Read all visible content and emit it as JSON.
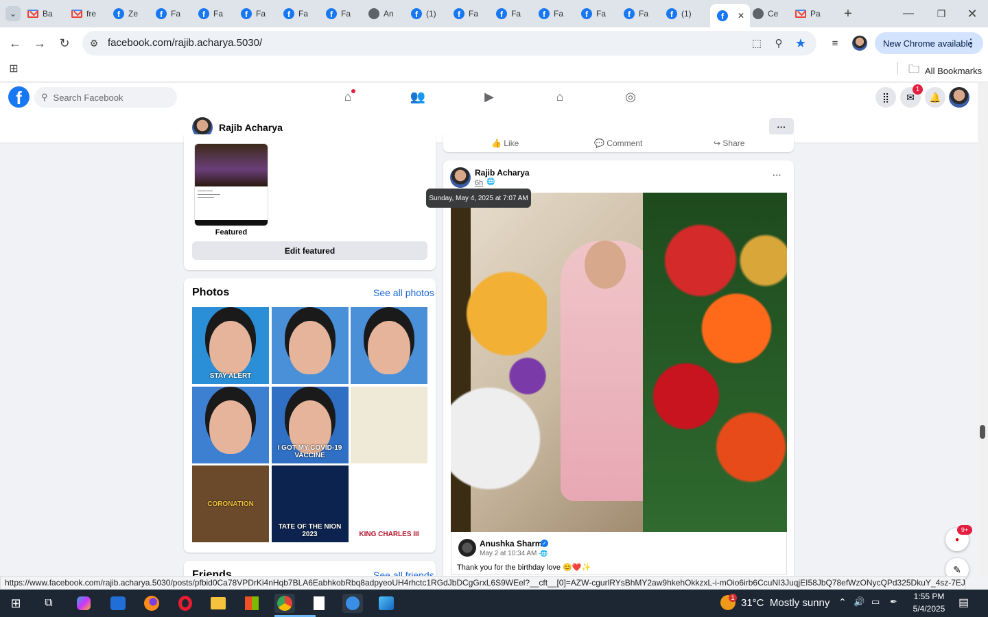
{
  "browser": {
    "tabs": [
      {
        "icon": "gmail-icon",
        "label": "Ba"
      },
      {
        "icon": "gmail-icon",
        "label": "fre"
      },
      {
        "icon": "facebook-icon",
        "label": "Ze"
      },
      {
        "icon": "facebook-icon",
        "label": "Fa"
      },
      {
        "icon": "facebook-icon",
        "label": "Fa"
      },
      {
        "icon": "facebook-icon",
        "label": "Fa"
      },
      {
        "icon": "facebook-icon",
        "label": "Fa"
      },
      {
        "icon": "facebook-icon",
        "label": "Fa"
      },
      {
        "icon": "globe-icon",
        "label": "An"
      },
      {
        "icon": "facebook-icon",
        "label": "(1)"
      },
      {
        "icon": "facebook-icon",
        "label": "Fa"
      },
      {
        "icon": "facebook-icon",
        "label": "Fa"
      },
      {
        "icon": "facebook-icon",
        "label": "Fa"
      },
      {
        "icon": "facebook-icon",
        "label": "Fa"
      },
      {
        "icon": "facebook-icon",
        "label": "Fa"
      },
      {
        "icon": "facebook-icon",
        "label": "(1)"
      },
      {
        "icon": "facebook-icon",
        "label": "",
        "active": true
      },
      {
        "icon": "globe-icon",
        "label": "Ce"
      },
      {
        "icon": "gmail-icon",
        "label": "Pa"
      }
    ],
    "url": "facebook.com/rajib.acharya.5030/",
    "new_chrome": "New Chrome available",
    "all_bookmarks": "All Bookmarks",
    "status_url": "https://www.facebook.com/rajib.acharya.5030/posts/pfbid0Ca78VPDrKi4nHqb7BLA6EabhkobRbq8adpyeoUH4rhctc1RGdJbDCgGrxL6S9WEel?__cft__[0]=AZW-cgurlRYsBhMY2aw9hkehOkkzxL-i-mOio6irb6CcuNI3JuqjEI58JbQ78efWzONycQPd325DkuY_4sz-7EJsisGU..."
  },
  "facebook": {
    "search_placeholder": "Search Facebook",
    "messenger_badge": "1",
    "profile_name": "Rajib Acharya",
    "featured_label": "Featured",
    "edit_featured": "Edit featured",
    "photos_title": "Photos",
    "see_all_photos": "See all photos",
    "friends_title": "Friends",
    "see_all_friends": "See all friends",
    "prev_post_actions": [
      "Like",
      "Comment",
      "Share"
    ],
    "post": {
      "author": "Rajib Acharya",
      "time": "6h",
      "tooltip": "Sunday, May 4, 2025 at 7:07 AM",
      "shared_author": "Anushka Sharma",
      "shared_time": "May 2 at 10:34 AM ·",
      "shared_text": "Thank you for the birthday love 😊❤️✨"
    },
    "photos": [
      {
        "name": "photo-stay-alert",
        "color": "#2a8fd6",
        "text": "STAY ALERT"
      },
      {
        "name": "photo-portrait-1",
        "color": "#4a90d9",
        "text": ""
      },
      {
        "name": "photo-portrait-2",
        "color": "#4a90d9",
        "text": ""
      },
      {
        "name": "photo-portrait-3",
        "color": "#3d7fd0",
        "text": ""
      },
      {
        "name": "photo-covid-vaccine",
        "color": "#2f6fc4",
        "text": "I GOT MY COVID-19 VACCINE"
      },
      {
        "name": "photo-invitation",
        "color": "#efe9d8",
        "text": ""
      },
      {
        "name": "photo-coronation",
        "color": "#6a4a2a",
        "text": "CORONATION"
      },
      {
        "name": "photo-state-of-union",
        "color": "#0c2350",
        "text": "TATE OF THE NION 2023"
      },
      {
        "name": "photo-king-charles",
        "color": "#ffffff",
        "text": "KING CHARLES III"
      }
    ],
    "notif_badge": "9+"
  },
  "taskbar": {
    "weather": "31°C  Mostly sunny",
    "weather_badge": "1",
    "time": "1:55 PM",
    "date": "5/4/2025"
  }
}
